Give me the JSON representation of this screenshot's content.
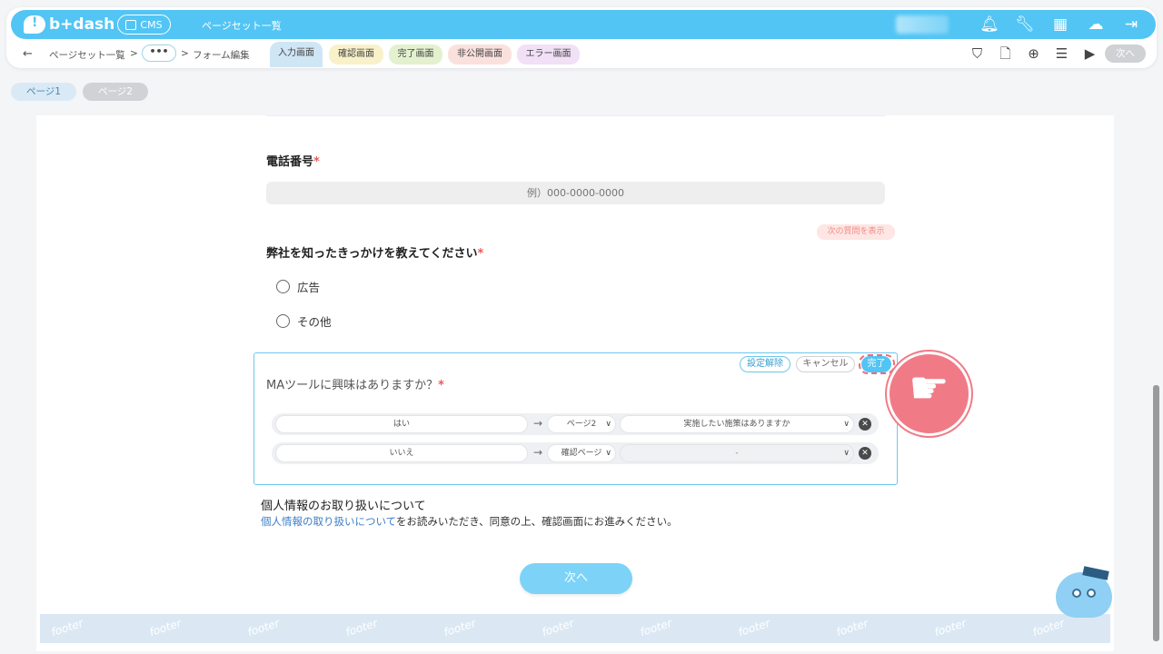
{
  "app": {
    "logo": "b+dash",
    "cms_label": "CMS",
    "top_title": "ページセット一覧"
  },
  "breadcrumb": {
    "back": "←",
    "item1": "ページセット一覧",
    "sep": ">",
    "dots": "•••",
    "item2": "フォーム編集"
  },
  "tabs": [
    {
      "label": "入力画面",
      "color": "#cfe6f5"
    },
    {
      "label": "確認画面",
      "color": "#f8f1c9"
    },
    {
      "label": "完了画面",
      "color": "#e3f1cf"
    },
    {
      "label": "非公開画面",
      "color": "#fbe1de"
    },
    {
      "label": "エラー画面",
      "color": "#f1e0f6"
    }
  ],
  "toolbar": {
    "next_label": "次へ"
  },
  "pages": [
    "ページ1",
    "ページ2"
  ],
  "form": {
    "phone_label": "電話番号",
    "phone_placeholder": "例）000-0000-0000",
    "next_question_btn": "次の質問を表示",
    "source_label": "弊社を知ったきっかけを教えてください",
    "source_options": [
      "広告",
      "その他"
    ],
    "ma_label": "MAツールに興味はありますか？",
    "required_mark": "*",
    "edit_buttons": {
      "unset": "設定解除",
      "cancel": "キャンセル",
      "done": "完了"
    },
    "rules": [
      {
        "answer": "はい",
        "page": "ページ2",
        "target": "実施したい施策はありますか"
      },
      {
        "answer": "いいえ",
        "page": "確認ページ",
        "target": "-"
      }
    ],
    "privacy_title": "個人情報のお取り扱いについて",
    "privacy_link": "個人情報の取り扱いについて",
    "privacy_text": "をお読みいただき、同意の上、確認画面にお進みください。",
    "submit": "次へ"
  },
  "footer_watermark": "footer",
  "colors": {
    "brand": "#52c5f5",
    "required": "#e85a5a",
    "link": "#3a7ec8"
  }
}
